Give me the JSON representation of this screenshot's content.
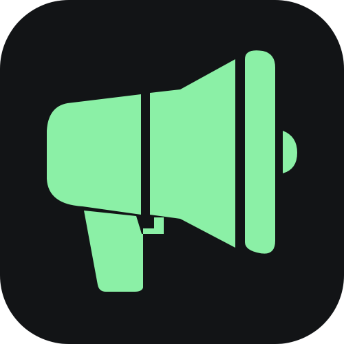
{
  "icon": {
    "name": "megaphone-icon",
    "background_color": "#121416",
    "foreground_color": "#8bf0a6"
  }
}
